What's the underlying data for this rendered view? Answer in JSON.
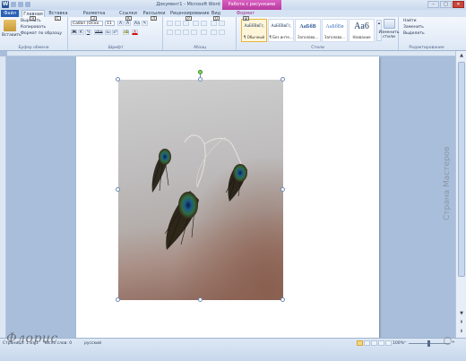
{
  "title_bar": {
    "app_icon_letter": "W",
    "window_title": "Документ1 - Microsoft Word",
    "context_tab_title": "Работа с рисунками",
    "minimize": "–",
    "maximize": "□",
    "close": "✕"
  },
  "tabs": {
    "file": "Файл",
    "items": [
      {
        "label": "Главная",
        "keytip": "Я"
      },
      {
        "label": "Вставка",
        "keytip": "C"
      },
      {
        "label": "Разметка страницы",
        "keytip": "З"
      },
      {
        "label": "Ссылки",
        "keytip": "К"
      },
      {
        "label": "Рассылки",
        "keytip": "Л"
      },
      {
        "label": "Рецензирование",
        "keytip": "Р"
      },
      {
        "label": "Вид",
        "keytip": "О"
      },
      {
        "label": "Формат",
        "keytip": "Ы"
      }
    ]
  },
  "ribbon": {
    "clipboard": {
      "paste": "Вставить",
      "cut": "Вырезать",
      "copy": "Копировать",
      "format_painter": "Формат по образцу",
      "group_label": "Буфер обмена"
    },
    "font": {
      "font_name": "Calibri (Осно",
      "font_size": "11",
      "bold": "Ж",
      "italic": "К",
      "underline": "Ч",
      "strike": "abe",
      "subscript": "x₂",
      "superscript": "x²",
      "grow": "A",
      "shrink": "A",
      "case": "Aa",
      "clear": "✎",
      "highlight": "ab",
      "color": "A",
      "group_label": "Шрифт"
    },
    "paragraph": {
      "group_label": "Абзац"
    },
    "styles": {
      "items": [
        {
          "sample": "АаБбВвГг,",
          "name": "¶ Обычный"
        },
        {
          "sample": "АаБбВвГг,",
          "name": "¶ Без инте..."
        },
        {
          "sample": "АаБбВ",
          "name": "Заголово..."
        },
        {
          "sample": "АаБбВв",
          "name": "Заголово..."
        },
        {
          "sample": "Aa6",
          "name": "Название"
        }
      ],
      "change_styles": "Изменить стили",
      "group_label": "Стили"
    },
    "editing": {
      "find": "Найти",
      "replace": "Заменить",
      "select": "Выделить",
      "group_label": "Редактирование"
    }
  },
  "status": {
    "page": "Страница: 1 из 1",
    "words": "Число слов: 0",
    "language": "русский",
    "zoom": "100%",
    "zoom_minus": "−",
    "zoom_plus": "+"
  },
  "watermark": {
    "signature": "Флорис",
    "site": "Страна Мастеров"
  },
  "colors": {
    "file_tab": "#2a60b5",
    "context_tab": "#b83aa0",
    "workspace": "#a8bedb",
    "selection_handle": "#6f8cb3",
    "rotate_handle": "#7ed957"
  }
}
